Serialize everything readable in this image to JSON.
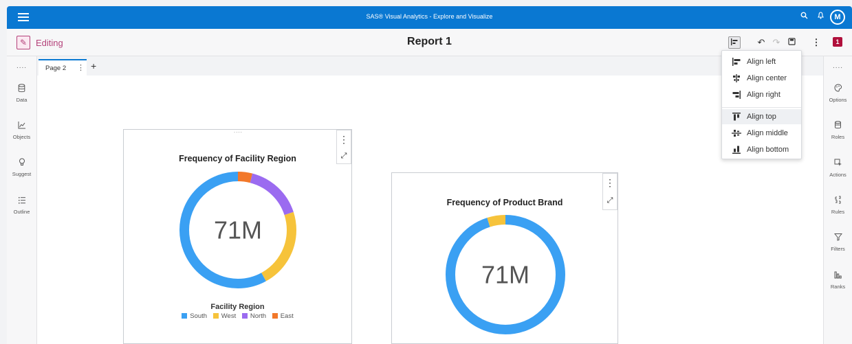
{
  "app": {
    "title": "SAS® Visual Analytics - Explore and Visualize",
    "user_initial": "M"
  },
  "toolbar": {
    "mode_label": "Editing",
    "report_title": "Report 1",
    "badge": "1"
  },
  "tabs": {
    "page_label": "Page 2"
  },
  "left_sidebar": {
    "dots": "....",
    "items": [
      {
        "label": "Data",
        "icon": "database-icon"
      },
      {
        "label": "Objects",
        "icon": "chart-line-icon"
      },
      {
        "label": "Suggest",
        "icon": "lightbulb-icon"
      },
      {
        "label": "Outline",
        "icon": "list-icon"
      }
    ]
  },
  "right_sidebar": {
    "dots": "....",
    "items": [
      {
        "label": "Options",
        "icon": "paint-icon"
      },
      {
        "label": "Roles",
        "icon": "roles-icon"
      },
      {
        "label": "Actions",
        "icon": "cursor-icon"
      },
      {
        "label": "Rules",
        "icon": "rules-icon"
      },
      {
        "label": "Filters",
        "icon": "filter-icon"
      },
      {
        "label": "Ranks",
        "icon": "ranks-icon"
      }
    ]
  },
  "align_menu": {
    "items": [
      {
        "label": "Align left",
        "icon": "align-left-icon"
      },
      {
        "label": "Align center",
        "icon": "align-center-icon"
      },
      {
        "label": "Align right",
        "icon": "align-right-icon"
      },
      {
        "label": "Align top",
        "icon": "align-top-icon"
      },
      {
        "label": "Align middle",
        "icon": "align-middle-icon"
      },
      {
        "label": "Align bottom",
        "icon": "align-bottom-icon"
      }
    ],
    "active_index": 3
  },
  "charts": [
    {
      "title": "Frequency of Facility Region",
      "center_value": "71M",
      "legend_title": "Facility Region",
      "legend": [
        {
          "label": "South",
          "color": "#3aa0f3"
        },
        {
          "label": "West",
          "color": "#f6c33b"
        },
        {
          "label": "North",
          "color": "#9b6bf0"
        },
        {
          "label": "East",
          "color": "#f2782a"
        }
      ]
    },
    {
      "title": "Frequency of Product Brand",
      "center_value": "71M"
    }
  ],
  "chart_data": [
    {
      "type": "pie",
      "title": "Frequency of Facility Region",
      "categories": [
        "South",
        "West",
        "North",
        "East"
      ],
      "values": [
        58,
        22,
        16,
        4
      ],
      "center_label": "71M",
      "legend_title": "Facility Region",
      "legend": "bottom"
    },
    {
      "type": "pie",
      "title": "Frequency of Product Brand",
      "categories": [
        "",
        ""
      ],
      "values": [
        95,
        5
      ],
      "colors": [
        "#3aa0f3",
        "#f6c33b"
      ],
      "center_label": "71M"
    }
  ]
}
